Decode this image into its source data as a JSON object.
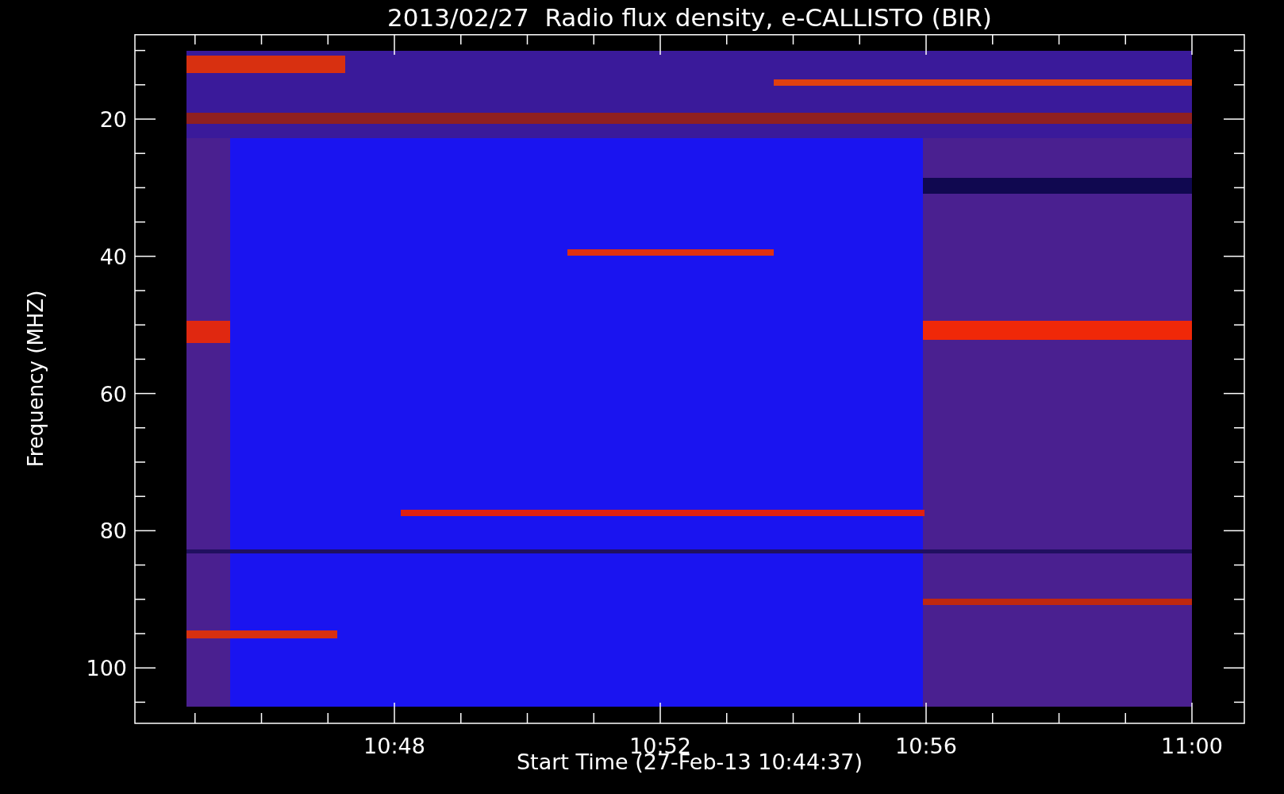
{
  "title": "2013/02/27  Radio flux density, e-CALLISTO (BIR)",
  "y_axis": {
    "label": "Frequency (MHZ)",
    "ticks": [
      "20",
      "40",
      "60",
      "80",
      "100"
    ]
  },
  "x_axis": {
    "label": "Start Time (27-Feb-13 10:44:37)",
    "ticks": [
      "10:48",
      "10:52",
      "10:56",
      "11:00"
    ]
  }
}
